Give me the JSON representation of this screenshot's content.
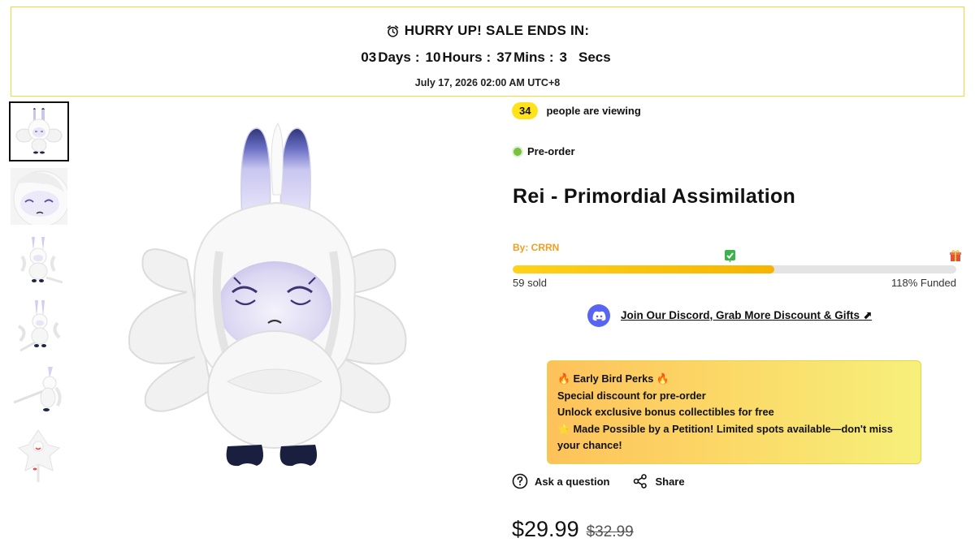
{
  "banner": {
    "title": "HURRY UP! SALE ENDS IN:",
    "icon": "alarm-clock-icon",
    "countdown": {
      "days": "03",
      "days_label": "Days",
      "hours": "10",
      "hours_label": "Hours",
      "mins": "37",
      "mins_label": "Mins",
      "secs": "3",
      "secs_label": "Secs",
      "separator": ":"
    },
    "end_date": "July 17, 2026 02:00 AM UTC+8"
  },
  "gallery": {
    "thumbnail_count": 6,
    "active_index": 0
  },
  "product": {
    "viewers_count": "34",
    "viewers_text": "people are viewing",
    "status": "Pre-order",
    "status_color": "#79c043",
    "title": "Rei - Primordial Assimilation",
    "by": "By: CRRN",
    "sold_text": "59 sold",
    "funded_text": "118% Funded",
    "progress_fraction": 0.59,
    "milestone_check_fraction": 0.49,
    "discord_text": "Join Our Discord, Grab More Discount & Gifts ⬈",
    "perks": {
      "line1": "🔥 Early Bird Perks 🔥",
      "line2": "Special discount for pre-order",
      "line3": "Unlock exclusive bonus collectibles for free",
      "line4": "⭐ Made Possible by a Petition! Limited spots available—don't miss your chance!"
    },
    "ask_label": "Ask a question",
    "share_label": "Share",
    "price_current": "$29.99",
    "price_old": "$32.99"
  },
  "colors": {
    "accent_yellow": "#ffe31a",
    "banner_border": "#f2d93a",
    "by_color": "#f0a020",
    "discord": "#5865f2"
  }
}
